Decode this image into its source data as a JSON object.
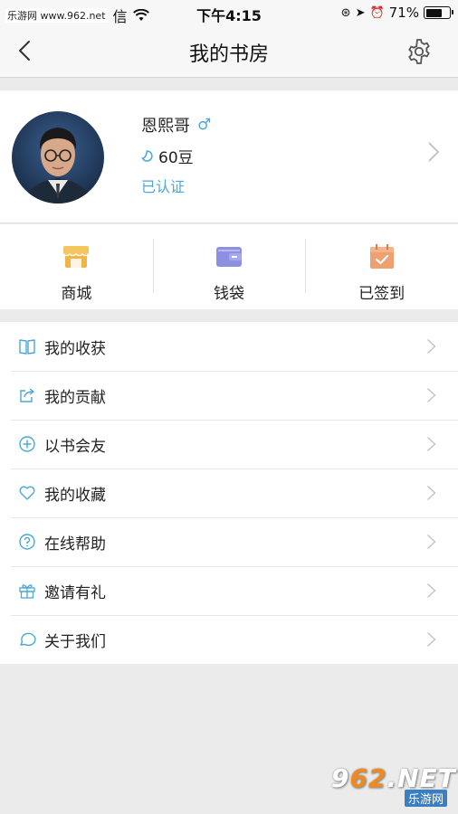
{
  "status_bar": {
    "watermark": "乐游网 www.962.net",
    "carrier": "信",
    "time": "下午4:15",
    "battery": "71%",
    "battery_level": 0.71
  },
  "nav": {
    "title": "我的书房",
    "back_icon": "chevron-left-icon",
    "settings_icon": "gear-icon"
  },
  "profile": {
    "name": "恩熙哥",
    "gender_symbol": "♂",
    "beans": "60豆",
    "verified": "已认证",
    "accent": "#4aa8d8"
  },
  "actions": [
    {
      "label": "商城",
      "icon": "store-icon",
      "color": "#f2b544"
    },
    {
      "label": "钱袋",
      "icon": "wallet-icon",
      "color": "#8d8fe0"
    },
    {
      "label": "已签到",
      "icon": "calendar-check-icon",
      "color": "#f0a070"
    }
  ],
  "menu": [
    {
      "label": "我的收获",
      "icon": "book-icon"
    },
    {
      "label": "我的贡献",
      "icon": "share-icon"
    },
    {
      "label": "以书会友",
      "icon": "plus-circle-icon"
    },
    {
      "label": "我的收藏",
      "icon": "heart-icon"
    },
    {
      "label": "在线帮助",
      "icon": "help-circle-icon"
    },
    {
      "label": "邀请有礼",
      "icon": "gift-icon"
    },
    {
      "label": "关于我们",
      "icon": "chat-bubble-icon"
    }
  ],
  "watermark": {
    "main_prefix": "9",
    "main_accent": "62",
    "main_suffix": ".NET",
    "sub": "乐游网"
  }
}
